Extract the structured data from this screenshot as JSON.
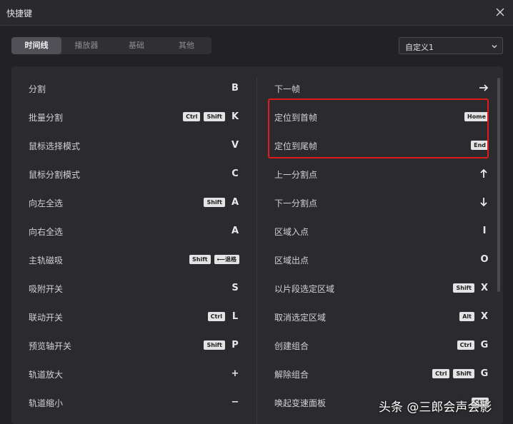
{
  "window": {
    "title": "快捷键"
  },
  "tabs": [
    {
      "label": "时间线",
      "active": true
    },
    {
      "label": "播放器",
      "active": false
    },
    {
      "label": "基础",
      "active": false
    },
    {
      "label": "其他",
      "active": false
    }
  ],
  "preset": {
    "selected": "自定义1"
  },
  "shortcuts_left": [
    {
      "label": "分割",
      "mods": [],
      "key": "B"
    },
    {
      "label": "批量分割",
      "mods": [
        "Ctrl",
        "Shift"
      ],
      "key": "K"
    },
    {
      "label": "鼠标选择模式",
      "mods": [],
      "key": "V"
    },
    {
      "label": "鼠标分割模式",
      "mods": [],
      "key": "C"
    },
    {
      "label": "向左全选",
      "mods": [
        "Shift"
      ],
      "key": "A"
    },
    {
      "label": "向右全选",
      "mods": [],
      "key": "A"
    },
    {
      "label": "主轨磁吸",
      "mods": [
        "Shift",
        "⟵退格"
      ],
      "key": ""
    },
    {
      "label": "吸附开关",
      "mods": [],
      "key": "S"
    },
    {
      "label": "联动开关",
      "mods": [
        "Ctrl"
      ],
      "key": "L"
    },
    {
      "label": "预览轴开关",
      "mods": [
        "Shift"
      ],
      "key": "P"
    },
    {
      "label": "轨道放大",
      "mods": [],
      "key": "+"
    },
    {
      "label": "轨道缩小",
      "mods": [],
      "key": "−"
    }
  ],
  "shortcuts_right": [
    {
      "label": "下一帧",
      "mods": [],
      "icon": "arrow-right-icon"
    },
    {
      "label": "定位到首帧",
      "mods": [
        "Home"
      ],
      "key": ""
    },
    {
      "label": "定位到尾帧",
      "mods": [
        "End"
      ],
      "key": ""
    },
    {
      "label": "上一分割点",
      "mods": [],
      "icon": "arrow-up-icon"
    },
    {
      "label": "下一分割点",
      "mods": [],
      "icon": "arrow-down-icon"
    },
    {
      "label": "区域入点",
      "mods": [],
      "key": "I"
    },
    {
      "label": "区域出点",
      "mods": [],
      "key": "O"
    },
    {
      "label": "以片段选定区域",
      "mods": [
        "Shift"
      ],
      "key": "X"
    },
    {
      "label": "取消选定区域",
      "mods": [
        "Alt"
      ],
      "key": "X"
    },
    {
      "label": "创建组合",
      "mods": [
        "Ctrl"
      ],
      "key": "G"
    },
    {
      "label": "解除组合",
      "mods": [
        "Ctrl",
        "Shift"
      ],
      "key": "G"
    },
    {
      "label": "唤起变速面板",
      "mods": [
        "Ctrl"
      ],
      "key": ""
    }
  ],
  "watermark": "头条 @三郎会声会影",
  "colors": {
    "highlight": "#e11b1b",
    "background": "#222226",
    "panel": "#2b2b2f"
  }
}
